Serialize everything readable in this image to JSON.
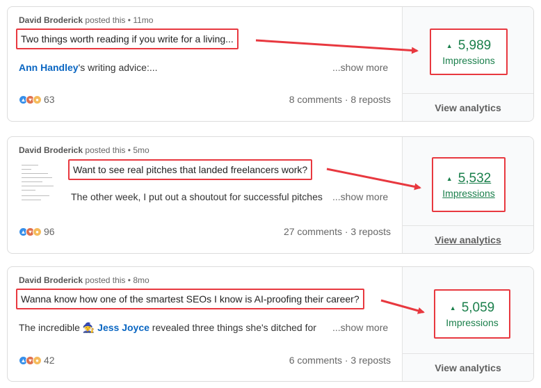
{
  "colors": {
    "annotation_red": "#e8383f",
    "impressions_green": "#1a7f4b",
    "mention_blue": "#0a66c2",
    "reaction_like": "#378fe9",
    "reaction_love": "#df704d",
    "reaction_insight": "#f5bb5c"
  },
  "posts": [
    {
      "author": "David Broderick",
      "posted_text": "posted this",
      "age": "11mo",
      "headline": "Two things worth reading if you write for a living...",
      "preview_mention": "Ann Handley",
      "preview_rest": "'s writing advice:...",
      "show_more": "...show more",
      "reaction_count": "63",
      "engagement": "8 comments · 8 reposts",
      "impressions_value": "5,989",
      "impressions_label": "Impressions",
      "view_analytics": "View analytics",
      "reactions": [
        "like-icon",
        "love-icon",
        "insightful-icon"
      ]
    },
    {
      "author": "David Broderick",
      "posted_text": "posted this",
      "age": "5mo",
      "headline": "Want to see real pitches that landed freelancers work?",
      "preview_text": "The other week, I put out a shoutout for successful pitches",
      "show_more": "...show more",
      "reaction_count": "96",
      "engagement": "27 comments · 3 reposts",
      "impressions_value": "5,532",
      "impressions_label": "Impressions",
      "view_analytics": "View analytics",
      "reactions": [
        "like-icon",
        "love-icon",
        "insightful-icon"
      ]
    },
    {
      "author": "David Broderick",
      "posted_text": "posted this",
      "age": "8mo",
      "headline": "Wanna know how one of the smartest SEOs I know is AI-proofing their career?",
      "preview_prefix": "The incredible",
      "preview_emoji": "🧙",
      "preview_mention": "Jess Joyce",
      "preview_rest": " revealed three things she's ditched for",
      "show_more": "...show more",
      "reaction_count": "42",
      "engagement": "6 comments · 3 reposts",
      "impressions_value": "5,059",
      "impressions_label": "Impressions",
      "view_analytics": "View analytics",
      "reactions": [
        "like-icon",
        "love-icon",
        "insightful-icon"
      ]
    }
  ]
}
